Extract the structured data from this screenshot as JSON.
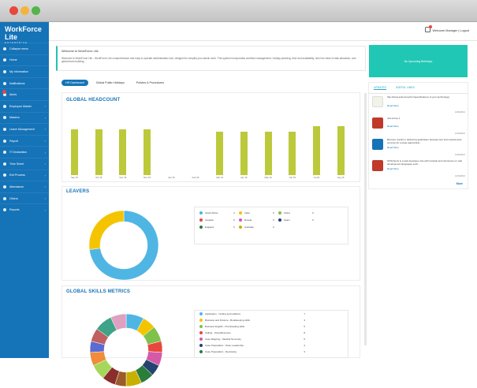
{
  "app": {
    "logo_text": "WorkForce Lite",
    "logo_sub": "ENTERPRISE"
  },
  "sidebar": {
    "items": [
      {
        "label": "Collapse menu",
        "chevron": false
      },
      {
        "label": "Home",
        "chevron": false
      },
      {
        "label": "My Information",
        "chevron": false
      },
      {
        "label": "Notifications",
        "chevron": false
      },
      {
        "label": "Alerts",
        "chevron": false
      },
      {
        "label": "Employee Master",
        "chevron": true
      },
      {
        "label": "Masters",
        "chevron": true
      },
      {
        "label": "Leave Management",
        "chevron": true
      },
      {
        "label": "Payroll",
        "chevron": true
      },
      {
        "label": "IT Declaration",
        "chevron": true
      },
      {
        "label": "Time Sheet",
        "chevron": true
      },
      {
        "label": "Exit Process",
        "chevron": true
      },
      {
        "label": "Attendance",
        "chevron": true
      },
      {
        "label": "Others",
        "chevron": true
      },
      {
        "label": "Reports",
        "chevron": true
      }
    ]
  },
  "topbar": {
    "user_text": "Welcome  Manager  |  Logout",
    "bell_badge": "1"
  },
  "welcome": {
    "heading": "Welcome to WorkForce Lite",
    "text": "Welcome to WorkForce Lite - WorkForce Lite comprehensive and easy to operate administration tool, designed to simplify your admin work. This system incorporates workflow management, holiday planning, time and availability, new hire ease of task allocation, and global team building."
  },
  "banner": {
    "text": "No Upcoming Birthdays"
  },
  "tabs": [
    "HR Dashboard",
    "Global Public Holidays",
    "Policies & Procedures"
  ],
  "headcount": {
    "title": "GLOBAL HEADCOUNT"
  },
  "chart_data": {
    "type": "bar",
    "categories": [
      "Sep 15",
      "Oct 15",
      "Nov 15",
      "Dec 15",
      "Jan 16",
      "Feb 16",
      "Mar 16",
      "Apr 16",
      "May 16",
      "Jun 16",
      "Jul 16",
      "Aug 16"
    ],
    "values": [
      40,
      40,
      40,
      40,
      0,
      0,
      38,
      38,
      38,
      38,
      43,
      43
    ],
    "ylim": [
      0,
      50
    ],
    "title": "GLOBAL HEADCOUNT",
    "xlabel": "",
    "ylabel": "",
    "color": "#bcc93a"
  },
  "leavers": {
    "title": "LEAVERS",
    "donut": [
      {
        "label": "South Africa",
        "pct": 73,
        "color": "#4fb6e3"
      },
      {
        "label": "India",
        "pct": 27,
        "color": "#f5c400"
      }
    ],
    "legend": [
      {
        "label": "South Africa",
        "value": "4",
        "color": "#4fb6e3"
      },
      {
        "label": "India",
        "value": "0",
        "color": "#f5c400"
      },
      {
        "label": "China",
        "value": "0",
        "color": "#7fc24b"
      },
      {
        "label": "Canada",
        "value": "0",
        "color": "#e8473e"
      },
      {
        "label": "Russia",
        "value": "0",
        "color": "#d45aa7"
      },
      {
        "label": "Spain",
        "value": "0",
        "color": "#24436e"
      },
      {
        "label": "England",
        "value": "0",
        "color": "#2b7d3c"
      },
      {
        "label": "Australia",
        "value": "0",
        "color": "#c9b000"
      }
    ]
  },
  "skills": {
    "title": "GLOBAL SKILLS METRICS",
    "items": [
      {
        "label": "Application - Coding and HotDocs",
        "value": "7",
        "color": "#4fb6e3"
      },
      {
        "label": "Business and Finance - Bookkeeping skills",
        "value": "3",
        "color": "#f5c400"
      },
      {
        "label": "Business English - Proofreading skills",
        "value": "5",
        "color": "#7fc24b"
      },
      {
        "label": "Calling - Voice/Resource",
        "value": "8",
        "color": "#e8473e"
      },
      {
        "label": "Case Mapping - Medical Summary",
        "value": "6",
        "color": "#d45aa7"
      },
      {
        "label": "Case Preparation - Team Leadership",
        "value": "4",
        "color": "#24436e"
      },
      {
        "label": "Case Preparation - Reviewing",
        "value": "3",
        "color": "#2b7d3c"
      }
    ],
    "donut": [
      {
        "pct": 8,
        "color": "#4fb6e3"
      },
      {
        "pct": 6,
        "color": "#f5c400"
      },
      {
        "pct": 7,
        "color": "#7fc24b"
      },
      {
        "pct": 5,
        "color": "#e8473e"
      },
      {
        "pct": 6,
        "color": "#d45aa7"
      },
      {
        "pct": 5,
        "color": "#24436e"
      },
      {
        "pct": 6,
        "color": "#2b7d3c"
      },
      {
        "pct": 7,
        "color": "#c9b000"
      },
      {
        "pct": 5,
        "color": "#9b5b2b"
      },
      {
        "pct": 6,
        "color": "#8c2d2d"
      },
      {
        "pct": 7,
        "color": "#a6d75b"
      },
      {
        "pct": 6,
        "color": "#f08c3a"
      },
      {
        "pct": 5,
        "color": "#5b6bd1"
      },
      {
        "pct": 6,
        "color": "#c06060"
      },
      {
        "pct": 8,
        "color": "#3fa38a"
      },
      {
        "pct": 7,
        "color": "#e0a0c0"
      }
    ]
  },
  "right": {
    "tabs": [
      "UPDATES",
      "USEFUL LINKS"
    ],
    "read_more": "Read More",
    "more": "More",
    "news": [
      {
        "text": "http://www.solomonsoft.in/specifications of your technology/",
        "date": "12/09/2016",
        "thumb": "#f2f2e6"
      },
      {
        "text": "Just Arrive 1",
        "date": "12/09/2016",
        "thumb": "#c0392b"
      },
      {
        "text": "Bonsoro results in delivering application development and maintenance services for a large agricultural...",
        "date": "12/09/2016",
        "thumb": "#1573b8"
      },
      {
        "text": "SOSchools is a web developer site with tutorials and references on web development languages such...",
        "date": "12/09/2016",
        "thumb": "#c0392b"
      }
    ]
  }
}
